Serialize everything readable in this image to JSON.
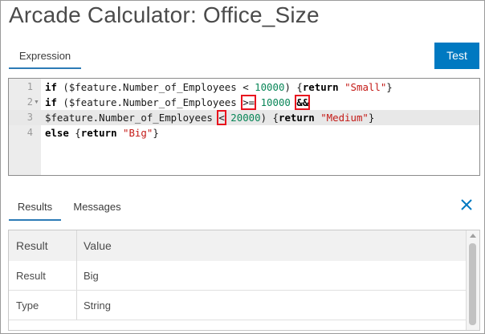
{
  "window": {
    "title": "Arcade Calculator: Office_Size"
  },
  "editor": {
    "tab_label": "Expression",
    "test_button_label": "Test",
    "lines": [
      {
        "number": "1",
        "tokens": {
          "t1": "if",
          "t2": " ($feature.Number_of_Employees ",
          "t3": "<",
          "t4": " ",
          "t5": "10000",
          "t6": ") {",
          "t7": "return",
          "t8": " ",
          "t9": "\"Small\"",
          "t10": "}"
        }
      },
      {
        "number": "2",
        "fold_icon": "fold-arrow-icon",
        "tokens": {
          "t1": "if",
          "t2": " ($feature.Number_of_Employees ",
          "t3": ">=",
          "t4": " ",
          "t5": "10000",
          "t6": " ",
          "t7": "&&"
        }
      },
      {
        "number": "3",
        "tokens": {
          "t1": "$feature.Number_of_Employees ",
          "t2": "<",
          "t3": " ",
          "t4": "20000",
          "t5": ") {",
          "t6": "return",
          "t7": " ",
          "t8": "\"Medium\"",
          "t9": "}"
        }
      },
      {
        "number": "4",
        "tokens": {
          "t1": "else",
          "t2": " {",
          "t3": "return",
          "t4": " ",
          "t5": "\"Big\"",
          "t6": "}"
        }
      }
    ],
    "highlight_color": "#e8141e"
  },
  "results_panel": {
    "tabs": [
      {
        "label": "Results"
      },
      {
        "label": "Messages"
      }
    ],
    "close_icon": "close-icon",
    "table": {
      "headers": [
        "Result",
        "Value"
      ],
      "rows": [
        [
          "Result",
          "Big"
        ],
        [
          "Type",
          "String"
        ]
      ]
    }
  },
  "colors": {
    "accent": "#0079c1",
    "tab_underline": "#2c7bb6",
    "number": "#098658",
    "string": "#c41a16"
  }
}
